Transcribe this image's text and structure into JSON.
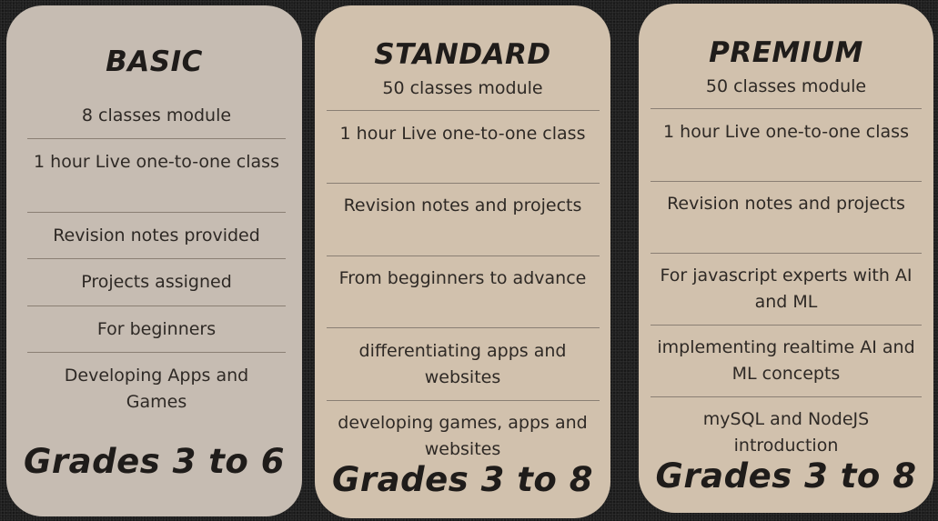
{
  "plans": {
    "basic": {
      "name": "BASIC",
      "features": [
        "8 classes module",
        "1 hour Live one-to-one class",
        "Revision notes provided",
        "Projects assigned",
        "For beginners",
        "Developing Apps and Games"
      ],
      "grades": "Grades 3 to 6"
    },
    "standard": {
      "name": "STANDARD",
      "module": "50 classes module",
      "features": [
        "1 hour Live one-to-one class",
        "Revision notes and projects",
        "From begginners to advance",
        "differentiating apps and websites",
        "developing games, apps and websites"
      ],
      "grades": "Grades 3 to 8"
    },
    "premium": {
      "name": "PREMIUM",
      "module": "50 classes module",
      "features": [
        "1 hour Live one-to-one class",
        "Revision notes and projects",
        "For javascript experts with AI and ML",
        "implementing realtime AI and ML concepts",
        "mySQL and NodeJS introduction"
      ],
      "grades": "Grades 3 to 8"
    }
  }
}
